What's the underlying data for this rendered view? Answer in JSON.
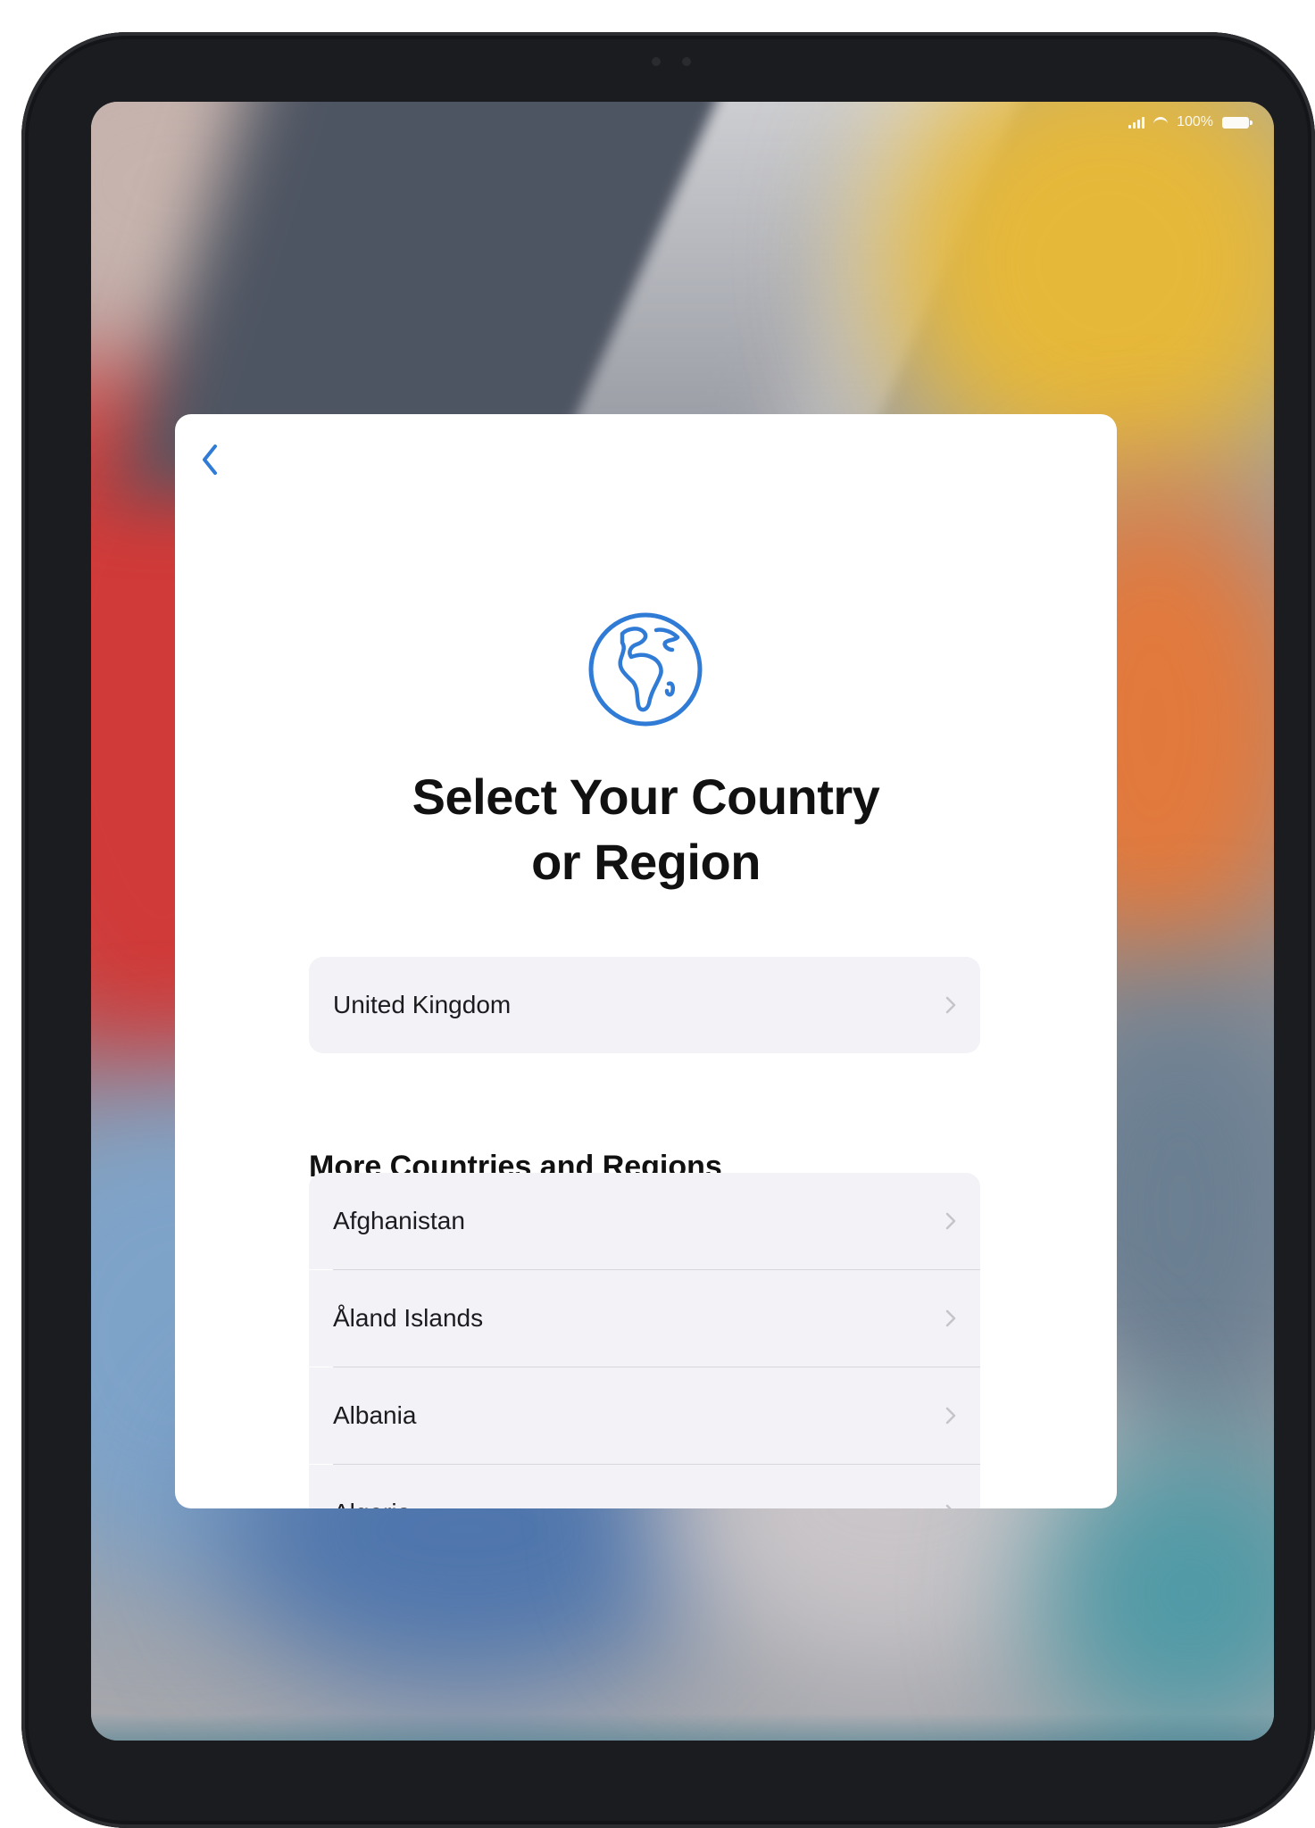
{
  "status_bar": {
    "battery_text": "100%"
  },
  "setup": {
    "title_line_1": "Select Your Country",
    "title_line_2": "or Region",
    "suggested_country": "United Kingdom",
    "section_header": "More Countries and Regions",
    "countries": [
      {
        "label": "Afghanistan"
      },
      {
        "label": "Åland Islands"
      },
      {
        "label": "Albania"
      },
      {
        "label": "Algeria"
      }
    ]
  },
  "icons": {
    "back": "chevron-left-icon",
    "globe": "globe-icon",
    "row_chevron": "chevron-right-icon"
  },
  "colors": {
    "accent": "#2f7bd6",
    "sheet_background": "#ffffff",
    "row_background": "#f2f2f7",
    "bezel": "#1b1c20"
  }
}
